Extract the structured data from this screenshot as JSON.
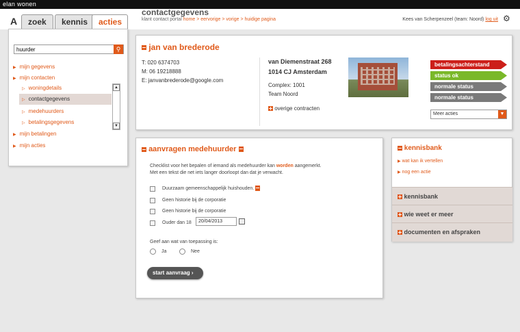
{
  "app": {
    "brand": "elan wonen",
    "logo": "A"
  },
  "tabs": [
    {
      "label": "zoek"
    },
    {
      "label": "kennis"
    },
    {
      "label": "acties"
    }
  ],
  "header": {
    "title": "contactgegevens",
    "crumb_prefix": "klant contact portal",
    "crumbs": [
      "home",
      "eervorige",
      "vorige",
      "huidige pagina"
    ],
    "sep": ">",
    "user": "Kees van Scherpenzeel (team: Noord)",
    "logout": "log uit"
  },
  "sidebar": {
    "search_value": "huurder",
    "items": [
      "mijn gegevens",
      "mijn contacten"
    ],
    "subitems": [
      "woningdetails",
      "contactgegevens",
      "medehuurders",
      "betalingsgegevens"
    ],
    "items2": [
      "mijn betalingen",
      "mijn acties"
    ]
  },
  "contact": {
    "name": "jan van brederode",
    "phone": "T:  020 6374703",
    "mobile": "M: 06 19218888",
    "email": "E:  janvanbrederode@google.com",
    "street": "van Diemenstraat 268",
    "city": "1014 CJ Amsterdam",
    "complex": "Complex: 1001",
    "team": "Team Noord",
    "other_contracts": "overige contracten",
    "statuses": [
      {
        "label": "betalingsachterstand",
        "color": "#cc1f1a"
      },
      {
        "label": "status ok",
        "color": "#7ab829"
      },
      {
        "label": "normale status",
        "color": "#7a7a7a"
      },
      {
        "label": "normale status",
        "color": "#7a7a7a"
      }
    ],
    "actions_select": "Meer acties"
  },
  "request": {
    "title": "aanvragen medehuurder",
    "intro1_pre": "Checklist voor het bepalen of iemand als medehuurder kan",
    "intro1_em": "worden",
    "intro1_post": "aangemerkt.",
    "intro2": "Met een tekst die net iets langer doorloopt dan dat je verwacht.",
    "checks": [
      "Duurzaam gemeenschappelijk huishouden.",
      "Geen historie bij de corporatie",
      "Geen historie bij de corporatie",
      "Ouder dan 18"
    ],
    "date": "20/04/2013",
    "question": "Geef aan wat van toepassing is:",
    "yes": "Ja",
    "no": "Nee",
    "submit": "start aanvraag"
  },
  "kennisbank": {
    "title": "kennisbank",
    "links": [
      "wat kan ik vertellen",
      "nog een actie"
    ],
    "sections": [
      "kennisbank",
      "wie weet er meer",
      "documenten en afspraken"
    ]
  },
  "colors": {
    "accent": "#e05a1a"
  }
}
